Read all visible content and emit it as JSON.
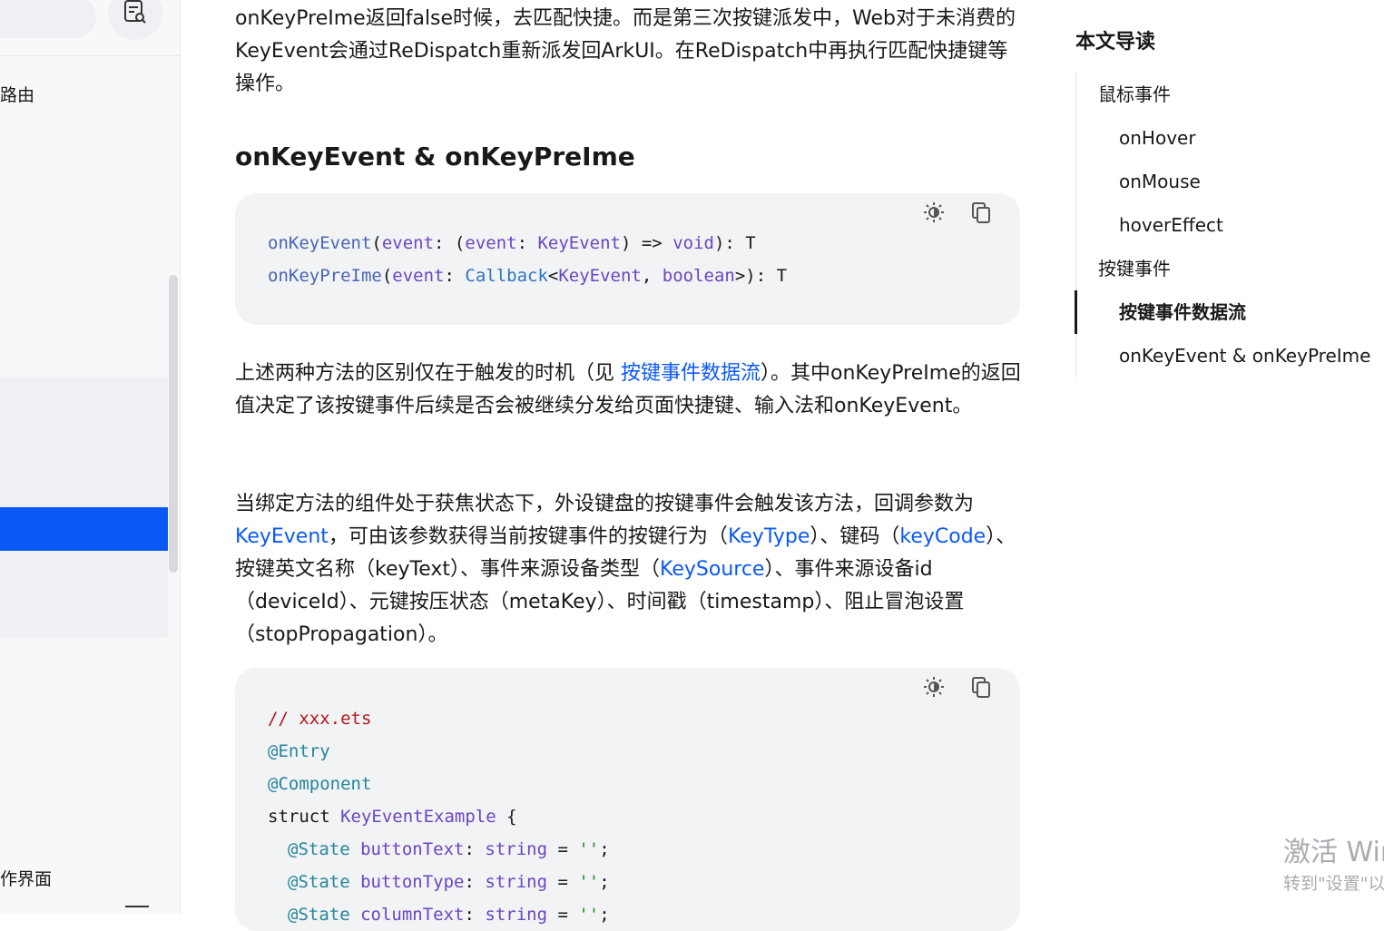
{
  "sidebar": {
    "items": [
      {
        "label": "路由"
      },
      {
        "label": "作界面"
      }
    ],
    "icons": {
      "filter": "document-search-icon"
    }
  },
  "article": {
    "intro": "onKeyPreIme返回false时候，去匹配快捷。而是第三次按键派发中，Web对于未消费的KeyEvent会通过ReDispatch重新派发回ArkUI。在ReDispatch中再执行匹配快捷键等操作。",
    "heading": "onKeyEvent & onKeyPreIme",
    "code1": {
      "line1": {
        "fn": "onKeyEvent",
        "p1": "(",
        "a1": "event",
        "p2": ": (",
        "a2": "event",
        "p3": ": ",
        "t1": "KeyEvent",
        "p4": ") => ",
        "t2": "void",
        "p5": "): T"
      },
      "line2": {
        "fn": "onKeyPreIme",
        "p1": "(",
        "a1": "event",
        "p2": ": ",
        "t1": "Callback",
        "p3": "<",
        "t2": "KeyEvent",
        "p4": ", ",
        "t3": "boolean",
        "p5": ">): T"
      }
    },
    "para2": {
      "t1": "上述两种方法的区别仅在于触发的时机（见 ",
      "link1": "按键事件数据流",
      "t2": "）。其中onKeyPreIme的返回值决定了该按键事件后续是否会被继续分发给页面快捷键、输入法和onKeyEvent。"
    },
    "para3": {
      "t1": "当绑定方法的组件处于获焦状态下，外设键盘的按键事件会触发该方法，回调参数为",
      "link1": "KeyEvent",
      "t2": "，可由该参数获得当前按键事件的按键行为（",
      "link2": "KeyType",
      "t3": "）、键码（",
      "link3": "keyCode",
      "t4": "）、按键英文名称（keyText）、事件来源设备类型（",
      "link4": "KeySource",
      "t5": "）、事件来源设备id（deviceId）、元键按压状态（metaKey）、时间戳（timestamp）、阻止冒泡设置（stopPropagation）。"
    },
    "code2": {
      "comment": "// xxx.ets",
      "entry": "@Entry",
      "component": "@Component",
      "struct_kw": "struct ",
      "struct_name": "KeyEventExample",
      "brace": " {",
      "state1": {
        "dec": "@State",
        "name": " buttonText",
        "colon": ": ",
        "type": "string",
        "eq": " = ",
        "val": "''",
        "semi": ";"
      },
      "state2": {
        "dec": "@State",
        "name": " buttonType",
        "colon": ": ",
        "type": "string",
        "eq": " = ",
        "val": "''",
        "semi": ";"
      },
      "state3": {
        "dec": "@State",
        "name": " columnText",
        "colon": ": ",
        "type": "string",
        "eq": " = ",
        "val": "''",
        "semi": ";"
      }
    },
    "code_tool_icons": [
      "theme-toggle-icon",
      "copy-icon"
    ]
  },
  "toc": {
    "title": "本文导读",
    "items": [
      {
        "label": "鼠标事件",
        "level": 1
      },
      {
        "label": "onHover",
        "level": 2
      },
      {
        "label": "onMouse",
        "level": 2
      },
      {
        "label": "hoverEffect",
        "level": 2
      },
      {
        "label": "按键事件",
        "level": 1
      },
      {
        "label": "按键事件数据流",
        "level": 2,
        "active": true
      },
      {
        "label": "onKeyEvent & onKeyPreIme",
        "level": 2
      }
    ]
  },
  "watermark": {
    "line1": "激活 Windows",
    "line2": "转到\"设置\"以激活 Windows。"
  },
  "colors": {
    "accent": "#0a59f7",
    "code_bg": "#f1f3f5",
    "sidebar_bg": "#f7f8fa"
  }
}
